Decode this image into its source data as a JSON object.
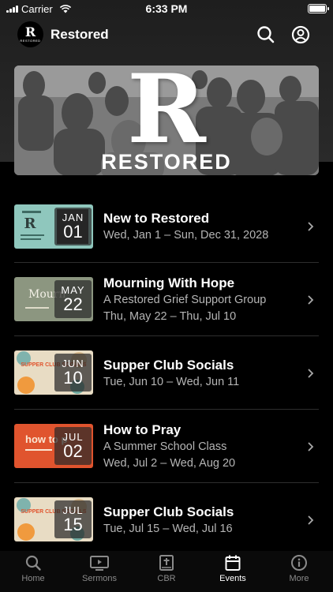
{
  "status": {
    "carrier": "Carrier",
    "time": "6:33 PM"
  },
  "app": {
    "title": "Restored",
    "logo_letter": "R",
    "logo_word": "RESTORED"
  },
  "banner": {
    "letter": "R",
    "word": "RESTORED"
  },
  "events": [
    {
      "title": "New to Restored",
      "lines": [
        "Wed, Jan 1 – Sun, Dec 31, 2028"
      ],
      "month": "JAN",
      "day": "01",
      "thumb_color": "#8fc7bd",
      "thumb_text": ""
    },
    {
      "title": "Mourning With Hope",
      "lines": [
        "A Restored Grief Support Group",
        "Thu, May 22 – Thu, Jul 10"
      ],
      "month": "MAY",
      "day": "22",
      "thumb_color": "#8c9680",
      "thumb_text": "Mourn"
    },
    {
      "title": "Supper Club Socials",
      "lines": [
        "Tue, Jun 10 – Wed, Jun 11"
      ],
      "month": "JUN",
      "day": "10",
      "thumb_color": "#e8dcc4",
      "thumb_text": "SUPPER CLUB SOCIALS"
    },
    {
      "title": "How to Pray",
      "lines": [
        "A Summer School Class",
        "Wed, Jul 2 – Wed, Aug 20"
      ],
      "month": "JUL",
      "day": "02",
      "thumb_color": "#e0542e",
      "thumb_text": "how to p"
    },
    {
      "title": "Supper Club Socials",
      "lines": [
        "Tue, Jul 15 – Wed, Jul 16"
      ],
      "month": "JUL",
      "day": "15",
      "thumb_color": "#e8dcc4",
      "thumb_text": "SUPPER CLUB SOCIALS"
    }
  ],
  "tabs": [
    {
      "label": "Home",
      "icon": "search-icon"
    },
    {
      "label": "Sermons",
      "icon": "play-screen-icon"
    },
    {
      "label": "CBR",
      "icon": "bible-icon"
    },
    {
      "label": "Events",
      "icon": "calendar-icon"
    },
    {
      "label": "More",
      "icon": "info-icon"
    }
  ],
  "colors": {
    "background": "#000000",
    "header": "#242424",
    "subtext": "#b5b5b5",
    "tab_inactive": "#8a8a8a",
    "tab_active": "#ffffff"
  }
}
